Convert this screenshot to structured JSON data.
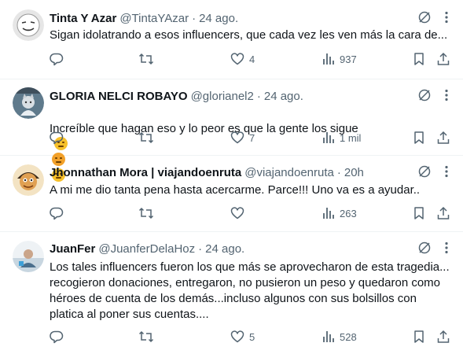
{
  "tweets": [
    {
      "name": "Tinta Y Azar",
      "handle": "@TintaYAzar",
      "sep": "·",
      "time": "24 ago.",
      "text": "Sigan idolatrando a esos influencers, que cada vez les ven más la cara de...",
      "emojis": [],
      "likes": "4",
      "views": "937",
      "avatar": "guy-fawkes-mask"
    },
    {
      "name": "GLORIA NELCI ROBAYO",
      "handle": "@glorianel2",
      "sep": "·",
      "time": "24 ago.",
      "text": "Increíble que hagan eso y lo peor es que la gente los sigue",
      "emojis": [
        "confounded-face",
        "angry-face",
        "disappointed-face"
      ],
      "likes": "7",
      "views": "1 mil",
      "avatar": "cat-photo"
    },
    {
      "name": "Jhonnathan Mora | viajandoenruta",
      "handle": "@viajandoenruta",
      "sep": "·",
      "time": "20h",
      "text": "A mi me dio tanta pena hasta acercarme. Parce!!! Uno va es a ayudar..",
      "emojis": [],
      "likes": "",
      "views": "263",
      "avatar": "cartoon-character"
    },
    {
      "name": "JuanFer",
      "handle": "@JuanferDelaHoz",
      "sep": "·",
      "time": "24 ago.",
      "text": "Los tales influencers fueron los que más se aprovecharon de esta tragedia...\nrecogieron donaciones, entregaron, no pusieron un peso y quedaron como\nhéroes de cuenta de los demás...incluso algunos con sus bolsillos con\nplatica al poner sus cuentas....",
      "emojis": [],
      "likes": "5",
      "views": "528",
      "avatar": "person-photo"
    }
  ],
  "icons": {
    "reply": "reply-icon",
    "retweet": "retweet-icon",
    "like": "heart-icon",
    "views": "views-icon",
    "bookmark": "bookmark-icon",
    "share": "share-icon",
    "grok": "grok-icon",
    "more": "more-icon"
  },
  "colors": {
    "text": "#0f1419",
    "secondary": "#536471",
    "divider": "#eff3f4"
  }
}
